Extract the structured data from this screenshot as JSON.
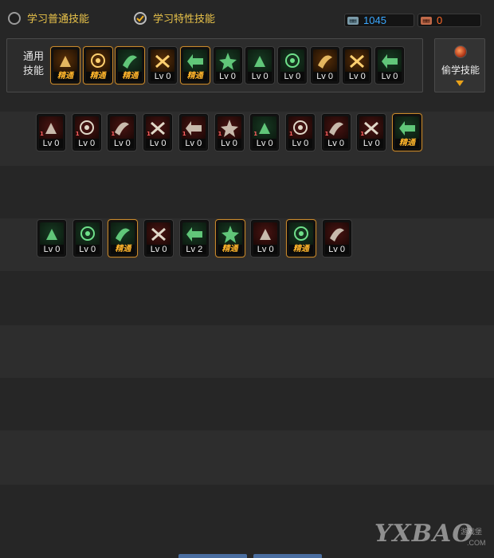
{
  "mode_options": {
    "normal": {
      "label": "学习普通技能",
      "selected": false
    },
    "special": {
      "label": "学习特性技能",
      "selected": true
    }
  },
  "counters": [
    {
      "icon": "book-icon",
      "value": "1045",
      "color": "#3aa8ff",
      "icon_bg": "#7a9aa8"
    },
    {
      "icon": "book-icon",
      "value": "0",
      "color": "#ff6a2a",
      "icon_bg": "#c06a4a"
    }
  ],
  "general_label": "通用技能",
  "steal_skill_label": "偷学技能",
  "colors": {
    "gold_frame": "#c98a2c",
    "master_text": "#ffb52b",
    "green_art": "#2fae4a",
    "red_art": "#8a1e1a",
    "orange_art": "#c87a1a"
  },
  "general_skills": [
    {
      "art": "sitting-figure-icon",
      "theme": "orange",
      "level": "精通",
      "master": true
    },
    {
      "art": "flame-figure-icon",
      "theme": "orange",
      "level": "精通",
      "master": true
    },
    {
      "art": "running-figure-icon",
      "theme": "green",
      "level": "精通",
      "master": true
    },
    {
      "art": "wings-icon",
      "theme": "orange",
      "level": "Lv 0",
      "master": false
    },
    {
      "art": "crosshair-icon",
      "theme": "green",
      "level": "精通",
      "master": true
    },
    {
      "art": "crosshair-icon",
      "theme": "green",
      "level": "Lv 0",
      "master": false
    },
    {
      "art": "warrior-icon",
      "theme": "green",
      "level": "Lv 0",
      "master": false
    },
    {
      "art": "dash-figure-icon",
      "theme": "green",
      "level": "Lv 0",
      "master": false
    },
    {
      "art": "eye-icon",
      "theme": "orange",
      "level": "Lv 0",
      "master": false
    },
    {
      "art": "fire-figure-icon",
      "theme": "orange",
      "level": "Lv 0",
      "master": false
    },
    {
      "art": "speed-figure-icon",
      "theme": "green",
      "level": "Lv 0",
      "master": false
    }
  ],
  "row2_skills": [
    {
      "art": "blade-icon",
      "theme": "red",
      "level": "Lv 0",
      "master": false,
      "tag": "1"
    },
    {
      "art": "claw-icon",
      "theme": "red",
      "level": "Lv 0",
      "master": false,
      "tag": "1"
    },
    {
      "art": "whirl-icon",
      "theme": "red",
      "level": "Lv 0",
      "master": false,
      "tag": "1"
    },
    {
      "art": "spiral-icon",
      "theme": "red",
      "level": "Lv 0",
      "master": false,
      "tag": "1"
    },
    {
      "art": "slash-icon",
      "theme": "red",
      "level": "Lv 0",
      "master": false,
      "tag": "1"
    },
    {
      "art": "explosion-icon",
      "theme": "red",
      "level": "Lv 0",
      "master": false,
      "tag": "1"
    },
    {
      "art": "cannon-icon",
      "theme": "green",
      "level": "Lv 0",
      "master": false,
      "tag": "1"
    },
    {
      "art": "grenade-icon",
      "theme": "red",
      "level": "Lv 0",
      "master": false,
      "tag": "1"
    },
    {
      "art": "burst-icon",
      "theme": "red",
      "level": "Lv 0",
      "master": false,
      "tag": "1"
    },
    {
      "art": "rapid-shot-icon",
      "theme": "red",
      "level": "Lv 0",
      "master": false,
      "tag": "1"
    },
    {
      "art": "running-figure-icon",
      "theme": "green",
      "level": "精通",
      "master": true,
      "tag": ""
    }
  ],
  "row3_skills": [
    {
      "art": "flag-icon",
      "theme": "green",
      "level": "Lv 0",
      "master": false
    },
    {
      "art": "target-figure-icon",
      "theme": "green",
      "level": "Lv 0",
      "master": false
    },
    {
      "art": "sparkle-icon",
      "theme": "green",
      "level": "精通",
      "master": true
    },
    {
      "art": "blade-icon",
      "theme": "red",
      "level": "Lv 0",
      "master": false
    },
    {
      "art": "tree-icon",
      "theme": "green",
      "level": "Lv 2",
      "master": false
    },
    {
      "art": "gunner-icon",
      "theme": "green",
      "level": "精通",
      "master": true
    },
    {
      "art": "gunner-icon",
      "theme": "red",
      "level": "Lv 0",
      "master": false
    },
    {
      "art": "swirl-shot-icon",
      "theme": "green",
      "level": "精通",
      "master": true
    },
    {
      "art": "dragon-icon",
      "theme": "red",
      "level": "Lv 0",
      "master": false
    }
  ],
  "watermark": {
    "brand": "YXBAO",
    "sub": "游戏堡",
    "domain": ".COM"
  }
}
